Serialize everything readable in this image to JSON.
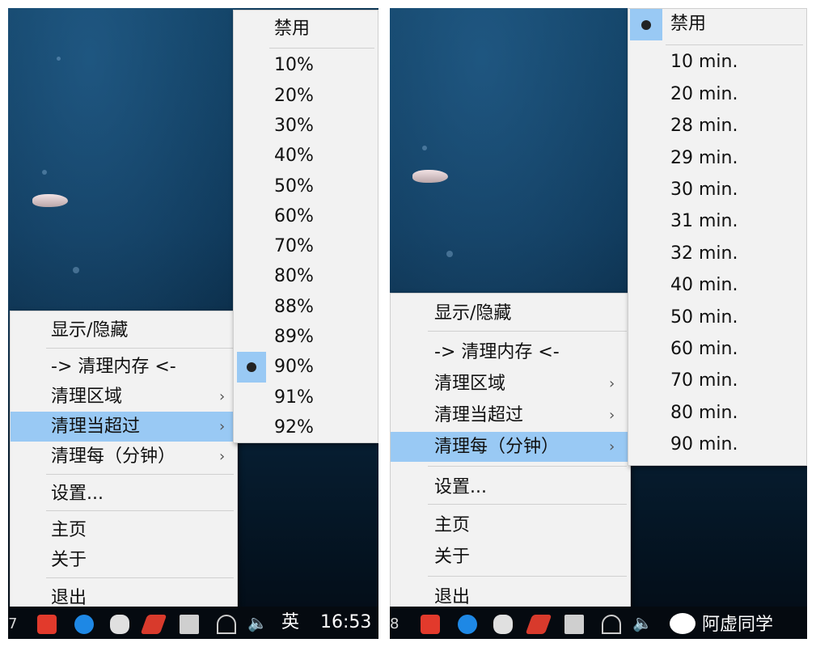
{
  "colors": {
    "highlight": "#99c9f4",
    "menu_bg": "#f2f2f2",
    "wallpaper_dark": "#030b12"
  },
  "left": {
    "main_menu": {
      "items": [
        {
          "label": "显示/隐藏"
        },
        {
          "label": "-> 清理内存 <-"
        },
        {
          "label": "清理区域",
          "arrow": "›"
        },
        {
          "label": "清理当超过",
          "arrow": "›",
          "selected": true
        },
        {
          "label": "清理每（分钟）",
          "arrow": "›"
        },
        {
          "label": "设置..."
        },
        {
          "label": "主页"
        },
        {
          "label": "关于"
        },
        {
          "label": "退出"
        }
      ]
    },
    "submenu": {
      "title": "禁用",
      "checked_index": 11,
      "items": [
        "禁用",
        "10%",
        "20%",
        "30%",
        "40%",
        "50%",
        "60%",
        "70%",
        "80%",
        "88%",
        "89%",
        "90%",
        "91%",
        "92%"
      ]
    },
    "taskbar": {
      "left_fragment": "7",
      "input_lang": "英",
      "clock": "16:53",
      "volume_icon": "speaker-icon"
    }
  },
  "right": {
    "main_menu": {
      "items": [
        {
          "label": "显示/隐藏"
        },
        {
          "label": "-> 清理内存 <-"
        },
        {
          "label": "清理区域",
          "arrow": "›"
        },
        {
          "label": "清理当超过",
          "arrow": "›"
        },
        {
          "label": "清理每（分钟）",
          "arrow": "›",
          "selected": true
        },
        {
          "label": "设置..."
        },
        {
          "label": "主页"
        },
        {
          "label": "关于"
        },
        {
          "label": "退出"
        }
      ]
    },
    "submenu": {
      "checked_index": 0,
      "items": [
        "禁用",
        "10 min.",
        "20 min.",
        "28 min.",
        "29 min.",
        "30 min.",
        "31 min.",
        "32 min.",
        "40 min.",
        "50 min.",
        "60 min.",
        "70 min.",
        "80 min.",
        "90 min."
      ]
    },
    "taskbar": {
      "left_fragment": "8",
      "wechat_label": "阿虚同学",
      "volume_icon": "speaker-icon"
    }
  }
}
